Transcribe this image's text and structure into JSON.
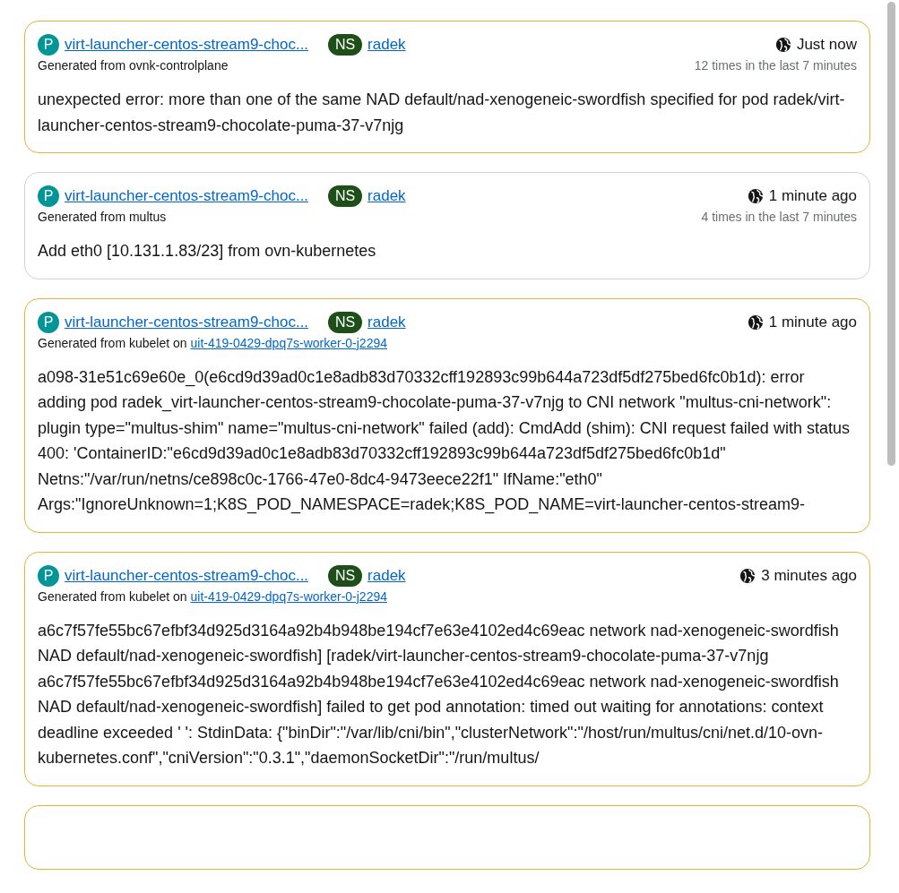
{
  "events": [
    {
      "color": "#e6b435",
      "pod_badge": "P",
      "pod": "virt-launcher-centos-stream9-choc...",
      "ns_badge": "NS",
      "namespace": "radek",
      "time": "Just now",
      "source": "Generated from ovnk-controlplane",
      "count": "12 times in the last 7 minutes",
      "message": "unexpected error: more than one of the same NAD default/nad-xenogeneic-swordfish specified for pod radek/virt-launcher-centos-stream9-chocolate-puma-37-v7njg"
    },
    {
      "color": "#d2d2d2",
      "pod_badge": "P",
      "pod": "virt-launcher-centos-stream9-choc...",
      "ns_badge": "NS",
      "namespace": "radek",
      "time": "1 minute ago",
      "source": "Generated from multus",
      "count": "4 times in the last 7 minutes",
      "message": "Add eth0 [10.131.1.83/23] from ovn-kubernetes"
    },
    {
      "color": "#e6b435",
      "pod_badge": "P",
      "pod": "virt-launcher-centos-stream9-choc...",
      "ns_badge": "NS",
      "namespace": "radek",
      "time": "1 minute ago",
      "source": "Generated from kubelet on",
      "node": "uit-419-0429-dpq7s-worker-0-j2294",
      "message": "a098-31e51c69e60e_0(e6cd9d39ad0c1e8adb83d70332cff192893c99b644a723df5df275bed6fc0b1d): error adding pod radek_virt-launcher-centos-stream9-chocolate-puma-37-v7njg to CNI network \"multus-cni-network\": plugin type=\"multus-shim\" name=\"multus-cni-network\" failed (add): CmdAdd (shim): CNI request failed with status 400: 'ContainerID:\"e6cd9d39ad0c1e8adb83d70332cff192893c99b644a723df5df275bed6fc0b1d\" Netns:\"/var/run/netns/ce898c0c-1766-47e0-8dc4-9473eece22f1\" IfName:\"eth0\" Args:\"IgnoreUnknown=1;K8S_POD_NAMESPACE=radek;K8S_POD_NAME=virt-launcher-centos-stream9-"
    },
    {
      "color": "#e6b435",
      "pod_badge": "P",
      "pod": "virt-launcher-centos-stream9-choc...",
      "ns_badge": "NS",
      "namespace": "radek",
      "time": "3 minutes ago",
      "source": "Generated from kubelet on",
      "node": "uit-419-0429-dpq7s-worker-0-j2294",
      "message": "a6c7f57fe55bc67efbf34d925d3164a92b4b948be194cf7e63e4102ed4c69eac network nad-xenogeneic-swordfish NAD default/nad-xenogeneic-swordfish] [radek/virt-launcher-centos-stream9-chocolate-puma-37-v7njg a6c7f57fe55bc67efbf34d925d3164a92b4b948be194cf7e63e4102ed4c69eac network nad-xenogeneic-swordfish NAD default/nad-xenogeneic-swordfish] failed to get pod annotation: timed out waiting for annotations: context deadline exceeded ' ': StdinData: {\"binDir\":\"/var/lib/cni/bin\",\"clusterNetwork\":\"/host/run/multus/cni/net.d/10-ovn-kubernetes.conf\",\"cniVersion\":\"0.3.1\",\"daemonSocketDir\":\"/run/multus/"
    },
    {
      "color": "#e6b435"
    }
  ]
}
